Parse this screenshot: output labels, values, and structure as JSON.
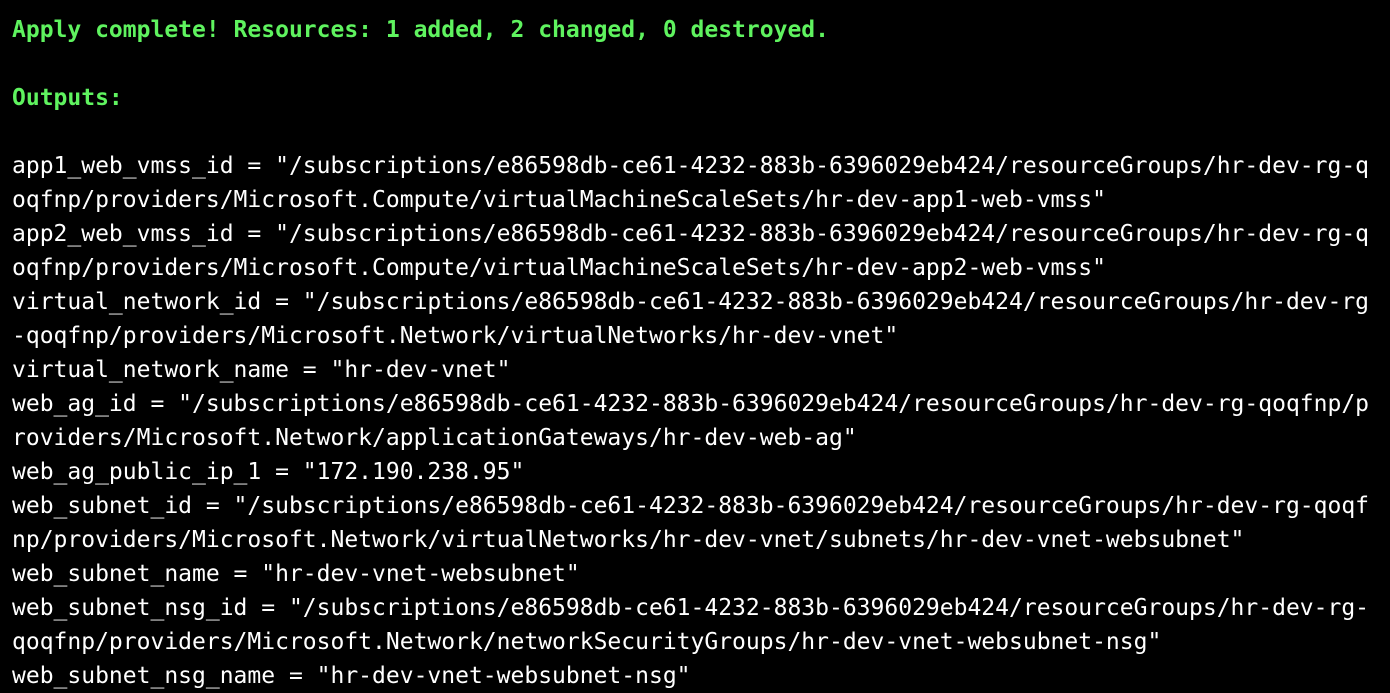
{
  "terminal": {
    "apply_line": "Apply complete! Resources: 1 added, 2 changed, 0 destroyed.",
    "outputs_heading": "Outputs:",
    "colors": {
      "background": "#000000",
      "text": "#ffffff",
      "success": "#5ff35f"
    },
    "lines": [
      "app1_web_vmss_id = \"/subscriptions/e86598db-ce61-4232-883b-6396029eb424/resourceGroups/hr-dev-rg-q",
      "oqfnp/providers/Microsoft.Compute/virtualMachineScaleSets/hr-dev-app1-web-vmss\"",
      "app2_web_vmss_id = \"/subscriptions/e86598db-ce61-4232-883b-6396029eb424/resourceGroups/hr-dev-rg-q",
      "oqfnp/providers/Microsoft.Compute/virtualMachineScaleSets/hr-dev-app2-web-vmss\"",
      "virtual_network_id = \"/subscriptions/e86598db-ce61-4232-883b-6396029eb424/resourceGroups/hr-dev-rg",
      "-qoqfnp/providers/Microsoft.Network/virtualNetworks/hr-dev-vnet\"",
      "virtual_network_name = \"hr-dev-vnet\"",
      "web_ag_id = \"/subscriptions/e86598db-ce61-4232-883b-6396029eb424/resourceGroups/hr-dev-rg-qoqfnp/p",
      "roviders/Microsoft.Network/applicationGateways/hr-dev-web-ag\"",
      "web_ag_public_ip_1 = \"172.190.238.95\"",
      "web_subnet_id = \"/subscriptions/e86598db-ce61-4232-883b-6396029eb424/resourceGroups/hr-dev-rg-qoqf",
      "np/providers/Microsoft.Network/virtualNetworks/hr-dev-vnet/subnets/hr-dev-vnet-websubnet\"",
      "web_subnet_name = \"hr-dev-vnet-websubnet\"",
      "web_subnet_nsg_id = \"/subscriptions/e86598db-ce61-4232-883b-6396029eb424/resourceGroups/hr-dev-rg-",
      "qoqfnp/providers/Microsoft.Network/networkSecurityGroups/hr-dev-vnet-websubnet-nsg\"",
      "web_subnet_nsg_name = \"hr-dev-vnet-websubnet-nsg\""
    ]
  }
}
